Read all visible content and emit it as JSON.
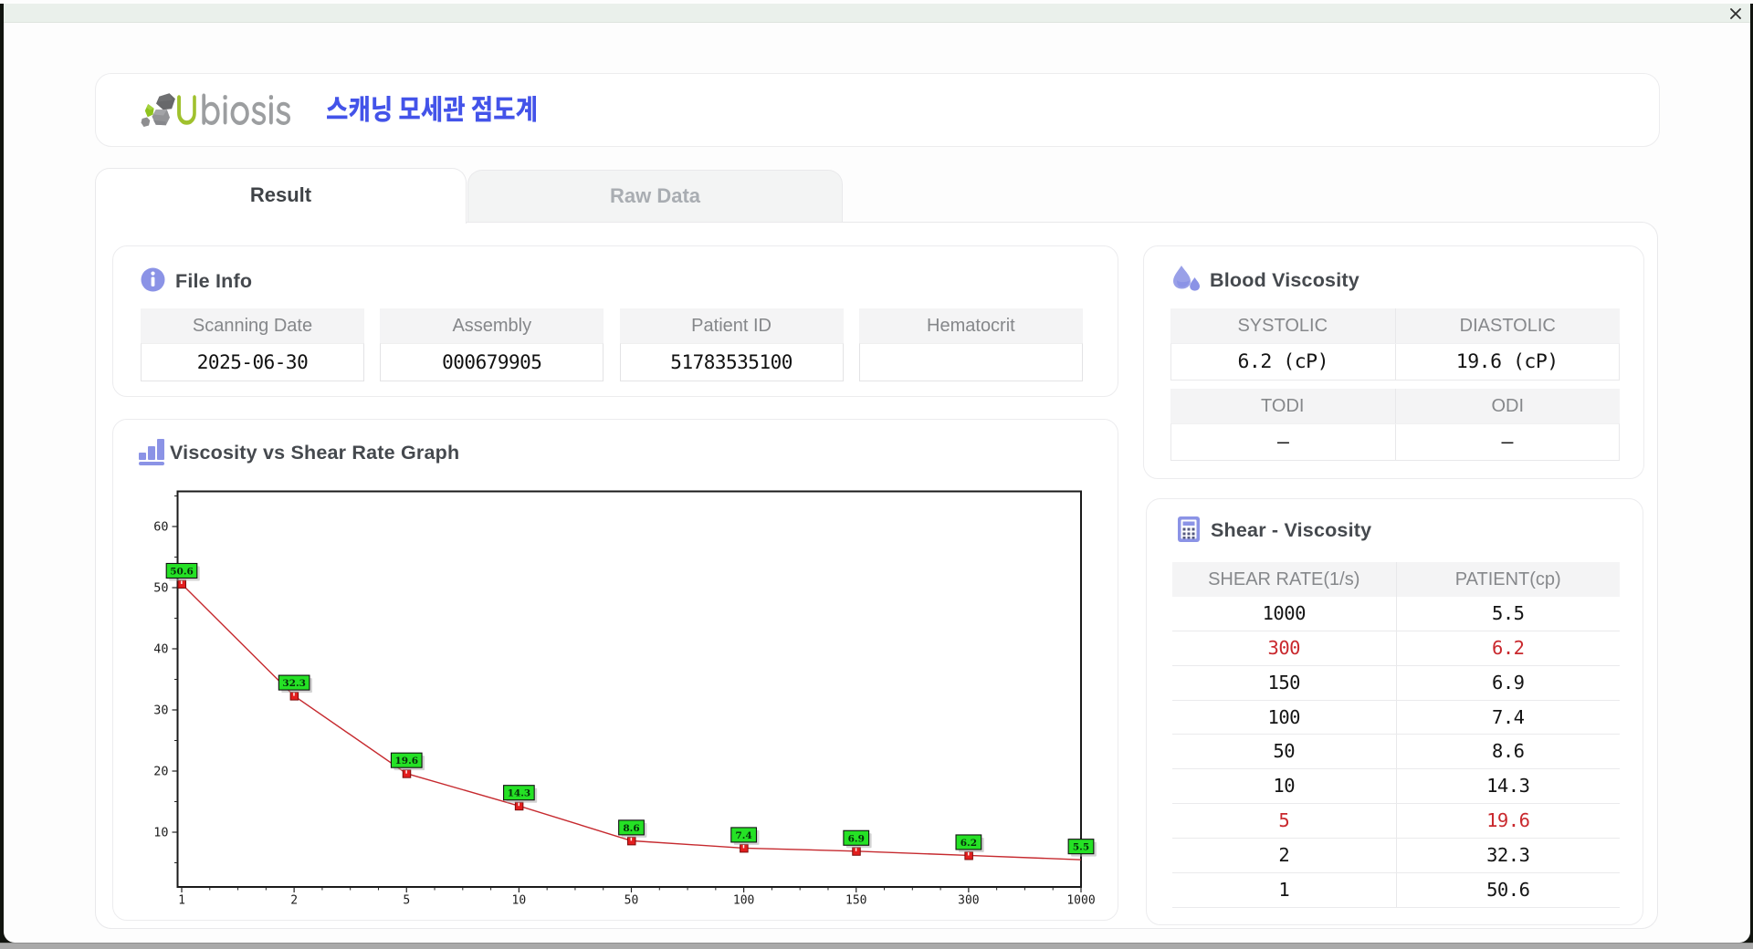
{
  "window": {
    "close_label": "close"
  },
  "brand": {
    "logo_text": "Ubiosis",
    "logo_accent_letter": "U",
    "logo_rest_letters": "biosis",
    "app_title": "스캐닝 모세관 점도계"
  },
  "tabs": [
    {
      "label": "Result",
      "active": true
    },
    {
      "label": "Raw Data",
      "active": false
    }
  ],
  "file_info": {
    "title": "File Info",
    "fields": [
      {
        "label": "Scanning Date",
        "value": "2025-06-30"
      },
      {
        "label": "Assembly",
        "value": "000679905"
      },
      {
        "label": "Patient ID",
        "value": "51783535100"
      },
      {
        "label": "Hematocrit",
        "value": ""
      }
    ]
  },
  "blood_viscosity": {
    "title": "Blood Viscosity",
    "sections": [
      {
        "cells": [
          {
            "label": "SYSTOLIC",
            "value": "6.2 (cP)"
          },
          {
            "label": "DIASTOLIC",
            "value": "19.6 (cP)"
          }
        ]
      },
      {
        "cells": [
          {
            "label": "TODI",
            "value": "–"
          },
          {
            "label": "ODI",
            "value": "–"
          }
        ]
      }
    ]
  },
  "shear_viscosity": {
    "title": "Shear - Viscosity",
    "columns": [
      "SHEAR RATE(1/s)",
      "PATIENT(cp)"
    ],
    "rows": [
      {
        "shear_rate": "1000",
        "patient": "5.5",
        "highlight": false
      },
      {
        "shear_rate": "300",
        "patient": "6.2",
        "highlight": true
      },
      {
        "shear_rate": "150",
        "patient": "6.9",
        "highlight": false
      },
      {
        "shear_rate": "100",
        "patient": "7.4",
        "highlight": false
      },
      {
        "shear_rate": "50",
        "patient": "8.6",
        "highlight": false
      },
      {
        "shear_rate": "10",
        "patient": "14.3",
        "highlight": false
      },
      {
        "shear_rate": "5",
        "patient": "19.6",
        "highlight": true
      },
      {
        "shear_rate": "2",
        "patient": "32.3",
        "highlight": false
      },
      {
        "shear_rate": "1",
        "patient": "50.6",
        "highlight": false
      }
    ]
  },
  "chart_data": {
    "type": "line",
    "title": "Viscosity vs Shear Rate Graph",
    "x_categories": [
      "1",
      "2",
      "5",
      "10",
      "50",
      "100",
      "150",
      "300",
      "1000"
    ],
    "values": [
      50.6,
      32.3,
      19.6,
      14.3,
      8.6,
      7.4,
      6.9,
      6.2,
      5.5
    ],
    "point_labels": [
      "50.6",
      "32.3",
      "19.6",
      "14.3",
      "8.6",
      "7.4",
      "6.9",
      "6.2",
      "5.5"
    ],
    "y_ticks": [
      10,
      20,
      30,
      40,
      50,
      60
    ],
    "ylim": [
      1,
      65.7
    ],
    "x_scale": "categorical",
    "x_minor_divisions": 4,
    "grid": "dashed",
    "xlabel": "",
    "ylabel": "",
    "legend": "none",
    "marker": "square",
    "colors": {
      "line": "#c62a2f",
      "marker": "#e31e1e",
      "marker_border": "#7c0a0a",
      "point_label_bg": "#25e125",
      "point_label_border": "#111111",
      "point_label_text": "#05300a"
    }
  },
  "colors": {
    "accent_icon": "#8b93e6",
    "app_title_blue": "#4353e9",
    "logo_green": "#a0c12d",
    "logo_gray": "#9c9ea0",
    "highlight_red": "#c9282d",
    "topbar_bg": "#eaf0eb"
  }
}
